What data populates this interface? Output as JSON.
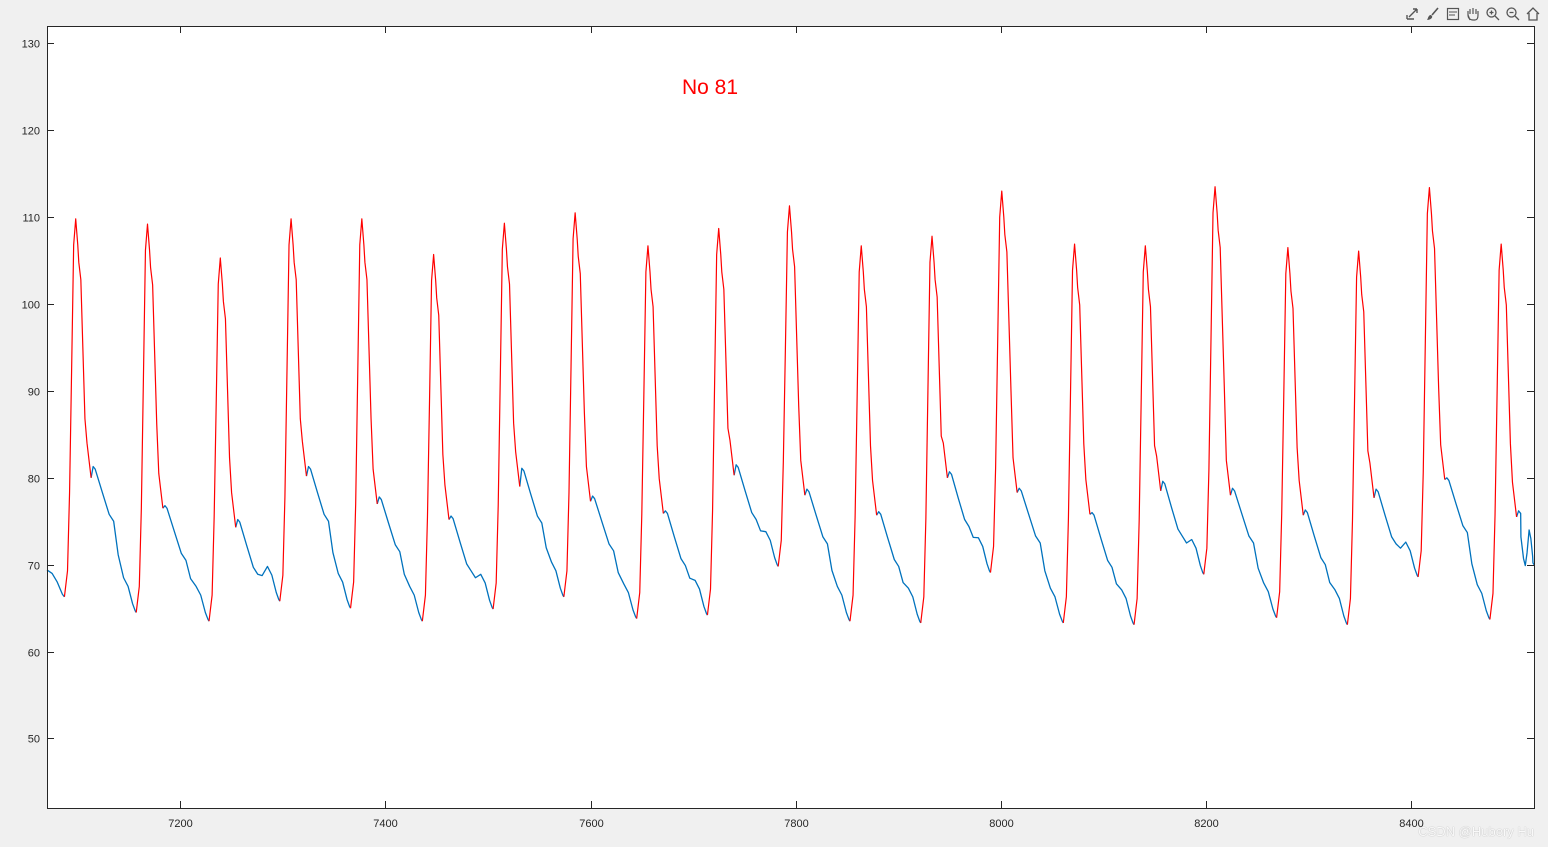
{
  "toolbar": {
    "icons": [
      "export-icon",
      "brush-icon",
      "datatips-icon",
      "pan-icon",
      "zoom-in-icon",
      "zoom-out-icon",
      "home-icon"
    ]
  },
  "watermark": "CSDN @Hubery Hu",
  "colors": {
    "background": "#f0f0f0",
    "axes": "#ffffff",
    "blue_series": "#0072BD",
    "red_series": "#FF0000",
    "annotation": "#FF0000"
  },
  "chart_data": {
    "type": "line",
    "annotation": "No 81",
    "xlim": [
      7070,
      8520
    ],
    "ylim": [
      42,
      132
    ],
    "xticks": [
      7200,
      7400,
      7600,
      7800,
      8000,
      8200,
      8400
    ],
    "yticks": [
      50,
      60,
      70,
      80,
      90,
      100,
      110,
      120,
      130
    ],
    "grid": false,
    "cycles": [
      {
        "foot_x": 7087,
        "foot_y": 66.3,
        "peak_x": 7098,
        "peak_y": 109.8,
        "notch_x": 7113,
        "notch_y": 80.0,
        "dicrotic_y": 81.3
      },
      {
        "foot_x": 7157,
        "foot_y": 64.5,
        "peak_x": 7168,
        "peak_y": 109.2,
        "notch_x": 7183,
        "notch_y": 76.5,
        "dicrotic_y": 76.8
      },
      {
        "foot_x": 7228,
        "foot_y": 63.5,
        "peak_x": 7239,
        "peak_y": 105.3,
        "notch_x": 7254,
        "notch_y": 74.3,
        "dicrotic_y": 75.2
      },
      {
        "foot_x": 7297,
        "foot_y": 65.8,
        "peak_x": 7308,
        "peak_y": 109.8,
        "notch_x": 7323,
        "notch_y": 80.2,
        "dicrotic_y": 81.3
      },
      {
        "foot_x": 7366,
        "foot_y": 65.0,
        "peak_x": 7377,
        "peak_y": 109.8,
        "notch_x": 7392,
        "notch_y": 77.0,
        "dicrotic_y": 77.8
      },
      {
        "foot_x": 7436,
        "foot_y": 63.5,
        "peak_x": 7447,
        "peak_y": 105.7,
        "notch_x": 7462,
        "notch_y": 75.2,
        "dicrotic_y": 75.6
      },
      {
        "foot_x": 7505,
        "foot_y": 64.9,
        "peak_x": 7516,
        "peak_y": 109.3,
        "notch_x": 7531,
        "notch_y": 79.0,
        "dicrotic_y": 81.1
      },
      {
        "foot_x": 7574,
        "foot_y": 66.3,
        "peak_x": 7585,
        "peak_y": 110.5,
        "notch_x": 7600,
        "notch_y": 77.3,
        "dicrotic_y": 77.9
      },
      {
        "foot_x": 7645,
        "foot_y": 63.8,
        "peak_x": 7656,
        "peak_y": 106.7,
        "notch_x": 7671,
        "notch_y": 75.9,
        "dicrotic_y": 76.2
      },
      {
        "foot_x": 7714,
        "foot_y": 64.2,
        "peak_x": 7725,
        "peak_y": 108.7,
        "notch_x": 7740,
        "notch_y": 80.3,
        "dicrotic_y": 81.5
      },
      {
        "foot_x": 7783,
        "foot_y": 69.8,
        "peak_x": 7794,
        "peak_y": 111.3,
        "notch_x": 7809,
        "notch_y": 78.0,
        "dicrotic_y": 78.7
      },
      {
        "foot_x": 7853,
        "foot_y": 63.5,
        "peak_x": 7864,
        "peak_y": 106.7,
        "notch_x": 7879,
        "notch_y": 75.7,
        "dicrotic_y": 76.1
      },
      {
        "foot_x": 7922,
        "foot_y": 63.3,
        "peak_x": 7933,
        "peak_y": 107.8,
        "notch_x": 7948,
        "notch_y": 80.0,
        "dicrotic_y": 80.7
      },
      {
        "foot_x": 7990,
        "foot_y": 69.1,
        "peak_x": 8001,
        "peak_y": 113.0,
        "notch_x": 8016,
        "notch_y": 78.3,
        "dicrotic_y": 78.8
      },
      {
        "foot_x": 8061,
        "foot_y": 63.3,
        "peak_x": 8072,
        "peak_y": 106.9,
        "notch_x": 8087,
        "notch_y": 75.8,
        "dicrotic_y": 76.0
      },
      {
        "foot_x": 8130,
        "foot_y": 63.1,
        "peak_x": 8141,
        "peak_y": 106.7,
        "notch_x": 8156,
        "notch_y": 78.5,
        "dicrotic_y": 79.6
      },
      {
        "foot_x": 8198,
        "foot_y": 68.9,
        "peak_x": 8209,
        "peak_y": 113.5,
        "notch_x": 8224,
        "notch_y": 78.0,
        "dicrotic_y": 78.8
      },
      {
        "foot_x": 8269,
        "foot_y": 63.9,
        "peak_x": 8280,
        "peak_y": 106.5,
        "notch_x": 8295,
        "notch_y": 75.7,
        "dicrotic_y": 76.3
      },
      {
        "foot_x": 8338,
        "foot_y": 63.1,
        "peak_x": 8349,
        "peak_y": 106.1,
        "notch_x": 8364,
        "notch_y": 77.7,
        "dicrotic_y": 78.7
      },
      {
        "foot_x": 8407,
        "foot_y": 68.6,
        "peak_x": 8418,
        "peak_y": 113.4,
        "notch_x": 8433,
        "notch_y": 79.8,
        "dicrotic_y": 80.0
      },
      {
        "foot_x": 8477,
        "foot_y": 63.7,
        "peak_x": 8488,
        "peak_y": 106.9,
        "notch_x": 8503,
        "notch_y": 75.5,
        "dicrotic_y": 76.2
      }
    ],
    "end_point": {
      "x": 8520,
      "y": 70.0
    },
    "start_y": 69.4
  }
}
